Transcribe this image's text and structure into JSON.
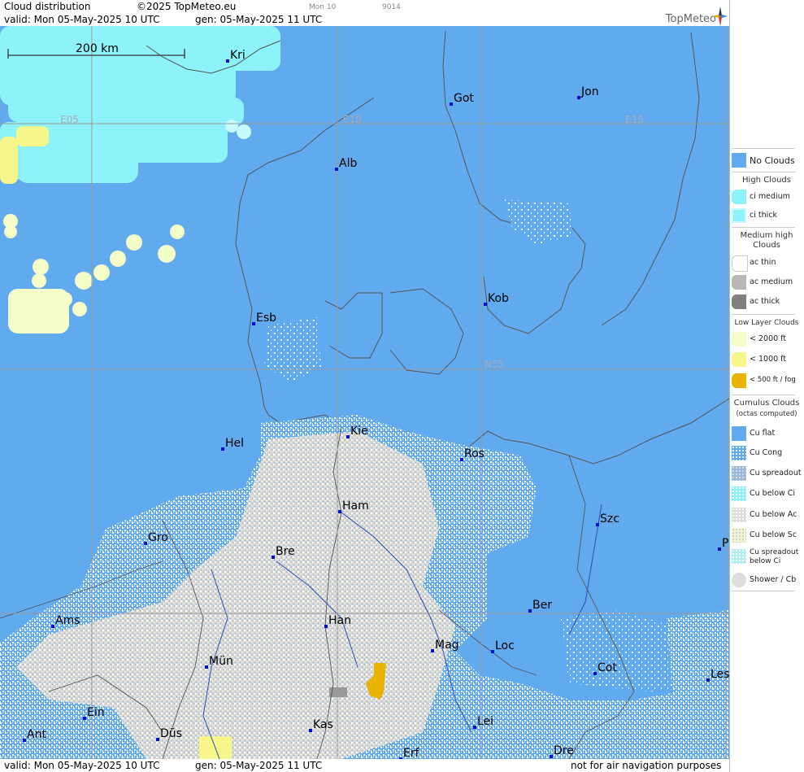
{
  "header": {
    "title": "Cloud distribution",
    "copyright": "©2025 TopMeteo.eu",
    "tag1": "Mon 10",
    "tag2": "9014",
    "valid_text": "valid:  Mon  05-May-2025  10 UTC",
    "gen_text": "gen: 05-May-2025 11 UTC",
    "logo": "TopMeteo"
  },
  "footer": {
    "valid_text": "valid:  Mon  05-May-2025  10 UTC",
    "gen_text": "gen: 05-May-2025 11 UTC",
    "disclaimer": "not for air navigation purposes"
  },
  "map": {
    "scale_label": "200 km",
    "grid_labels": [
      "E05",
      "E10",
      "E15",
      "N55"
    ],
    "cities": [
      "Kri",
      "Got",
      "Jon",
      "Alb",
      "Kob",
      "Esb",
      "Kie",
      "Hel",
      "Ros",
      "Ham",
      "Szc",
      "Gro",
      "Bre",
      "P",
      "Ber",
      "Ams",
      "Han",
      "Mag",
      "Loc",
      "Mün",
      "Cot",
      "Les",
      "Ein",
      "Kas",
      "Lei",
      "Ant",
      "Düs",
      "Dre",
      "Erf"
    ]
  },
  "legend": {
    "no_clouds": "No Clouds",
    "high_head": "High Clouds",
    "ci_medium": "ci medium",
    "ci_thick": "ci thick",
    "medium_head": "Medium high Clouds",
    "ac_thin": "ac thin",
    "ac_medium": "ac medium",
    "ac_thick": "ac thick",
    "low_head": "Low Layer Clouds",
    "low_2000": "< 2000 ft",
    "low_1000": "< 1000 ft",
    "low_500": "< 500 ft / fog",
    "cu_head": "Cumulus Clouds",
    "cu_sub": "(octas computed)",
    "cu_flat": "Cu flat",
    "cu_cong": "Cu Cong",
    "cu_spreadout": "Cu spreadout",
    "cu_below_ci": "Cu below Ci",
    "cu_below_ac": "Cu below Ac",
    "cu_below_sc": "Cu below Sc",
    "cu_spread_ci": "Cu spreadout below Ci",
    "shower": "Shower / Cb"
  },
  "colors": {
    "no_clouds": "#62aaee",
    "ci_medium": "#8ef2fa",
    "ci_thick": "#c6fafe",
    "low_2000": "#f4fcc8",
    "low_1000": "#f6f68a",
    "low_500": "#e8b400",
    "cu_fill": "#ffffff",
    "land_mix": "#c9c9c9"
  }
}
